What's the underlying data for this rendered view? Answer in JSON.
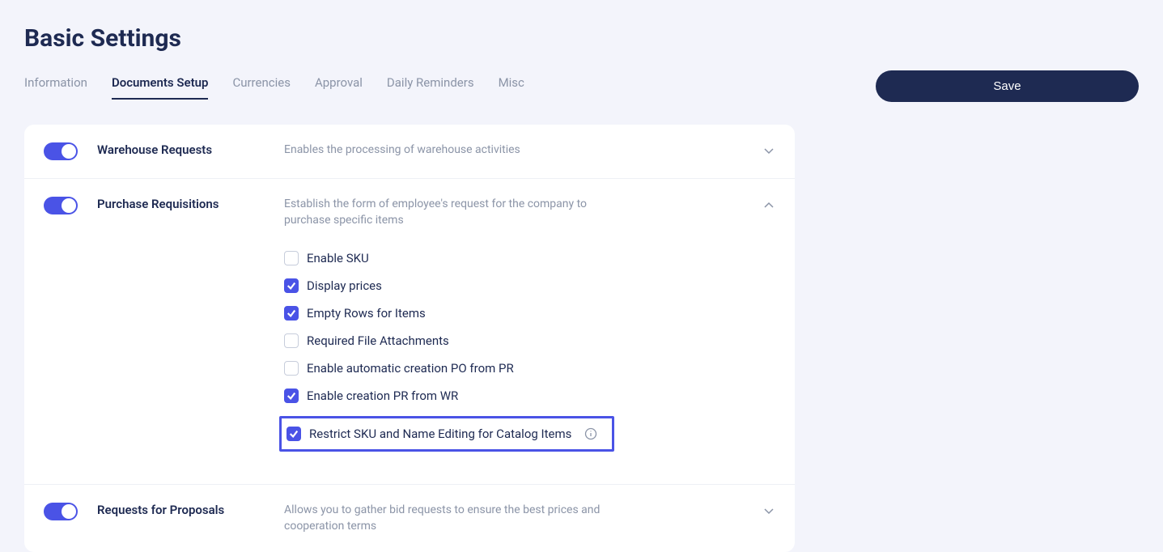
{
  "title": "Basic Settings",
  "save_label": "Save",
  "tabs": [
    {
      "label": "Information",
      "active": false
    },
    {
      "label": "Documents Setup",
      "active": true
    },
    {
      "label": "Currencies",
      "active": false
    },
    {
      "label": "Approval",
      "active": false
    },
    {
      "label": "Daily Reminders",
      "active": false
    },
    {
      "label": "Misc",
      "active": false
    }
  ],
  "sections": {
    "warehouse": {
      "title": "Warehouse Requests",
      "desc": "Enables the processing of warehouse activities",
      "enabled": true,
      "expanded": false
    },
    "purchase": {
      "title": "Purchase Requisitions",
      "desc": "Establish the form of employee's request for the company to purchase specific items",
      "enabled": true,
      "expanded": true,
      "options": [
        {
          "label": "Enable SKU",
          "checked": false
        },
        {
          "label": "Display prices",
          "checked": true
        },
        {
          "label": "Empty Rows for Items",
          "checked": true
        },
        {
          "label": "Required File Attachments",
          "checked": false
        },
        {
          "label": "Enable automatic creation PO from PR",
          "checked": false
        },
        {
          "label": "Enable creation PR from WR",
          "checked": true
        },
        {
          "label": "Restrict SKU and Name Editing for Catalog Items",
          "checked": true,
          "highlighted": true,
          "info": true
        }
      ]
    },
    "rfp": {
      "title": "Requests for Proposals",
      "desc": "Allows you to gather bid requests to ensure the best prices and cooperation terms",
      "enabled": true,
      "expanded": false
    }
  }
}
